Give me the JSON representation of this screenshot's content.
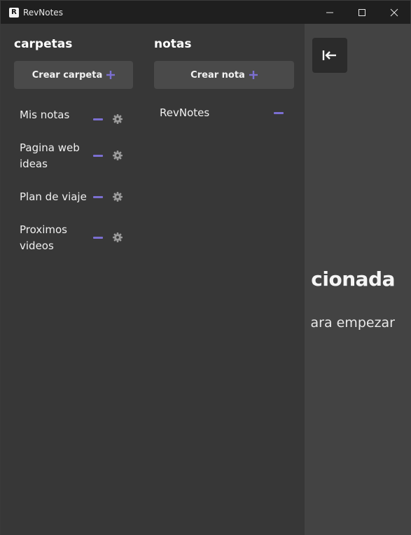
{
  "window": {
    "title": "RevNotes",
    "app_icon_glyph": "R",
    "controls": [
      "minimize-icon",
      "maximize-icon",
      "close-icon"
    ]
  },
  "colors": {
    "accent": "#7b6fd1",
    "sidebar_bg": "#373737",
    "main_bg": "#434343",
    "button_bg": "#4a4a4a"
  },
  "folders": {
    "title": "carpetas",
    "create_label": "Crear carpeta",
    "items": [
      {
        "label": "Mis notas"
      },
      {
        "label": "Pagina web ideas"
      },
      {
        "label": "Plan de viaje"
      },
      {
        "label": "Proximos videos"
      }
    ]
  },
  "notes": {
    "title": "notas",
    "create_label": "Crear nota",
    "items": [
      {
        "label": "RevNotes"
      }
    ]
  },
  "main": {
    "back_icon": "collapse-left-icon",
    "empty_title": "cionada",
    "empty_subtitle": "ara empezar"
  }
}
